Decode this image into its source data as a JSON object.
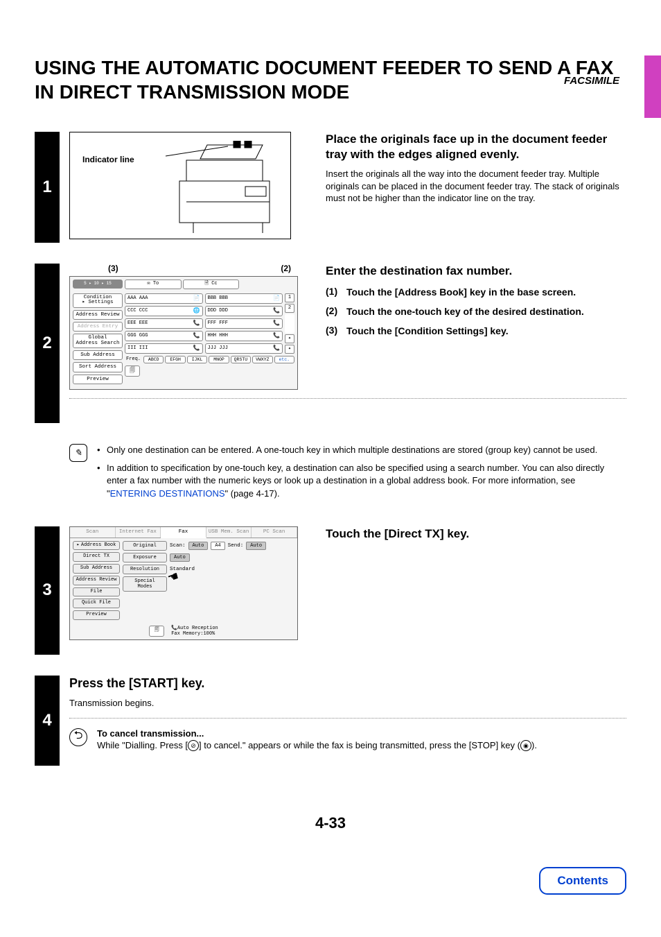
{
  "header": {
    "section": "FACSIMILE"
  },
  "title": "USING THE AUTOMATIC DOCUMENT FEEDER TO SEND A FAX IN DIRECT TRANSMISSION MODE",
  "steps": {
    "s1": {
      "num": "1",
      "indicator_label": "Indicator line",
      "heading": "Place the originals face up in the document feeder tray with the edges aligned evenly.",
      "para": "Insert the originals all the way into the document feeder tray. Multiple originals can be placed in the document feeder tray. The stack of originals must not be higher than the indicator line on the tray."
    },
    "s2": {
      "num": "2",
      "callout_left": "(3)",
      "callout_right": "(2)",
      "heading": "Enter the destination fax number.",
      "items": [
        {
          "n": "(1)",
          "t": "Touch the [Address Book] key in the base screen."
        },
        {
          "n": "(2)",
          "t": "Touch the one-touch key of the desired destination."
        },
        {
          "n": "(3)",
          "t": "Touch the [Condition Settings] key."
        }
      ],
      "panel": {
        "tab_to": "To",
        "tab_cc": "Cc",
        "side": [
          "Condition Settings",
          "Address Review",
          "Address Entry",
          "Global Address Search",
          "Sub Address",
          "Sort Address",
          "Preview"
        ],
        "keys": [
          [
            "AAA AAA",
            "BBB BBB"
          ],
          [
            "CCC CCC",
            "DDD DDD"
          ],
          [
            "EEE EEE",
            "FFF FFF"
          ],
          [
            "GGG GGG",
            "HHH HHH"
          ],
          [
            "III III",
            "JJJ JJJ"
          ]
        ],
        "scroll_top": "1",
        "scroll_bot": "2",
        "sort_label": "Freq.",
        "sort": [
          "ABCD",
          "EFGH",
          "IJKL",
          "MNOP",
          "QRSTU",
          "VWXYZ",
          "etc."
        ]
      },
      "note_b1": "Only one destination can be entered. A one-touch key in which multiple destinations are stored (group key) cannot be used.",
      "note_b2_pre": "In addition to specification by one-touch key, a destination can also be specified using a search number. You can also directly enter a fax number with the numeric keys or look up a destination in a global address book. For more information, see \"",
      "note_b2_link": "ENTERING DESTINATIONS",
      "note_b2_post": "\" (page 4-17)."
    },
    "s3": {
      "num": "3",
      "heading": "Touch the [Direct TX] key.",
      "panel": {
        "tabs": [
          "Scan",
          "Internet Fax",
          "Fax",
          "USB Mem. Scan",
          "PC Scan"
        ],
        "side": [
          "Address Book",
          "Direct TX",
          "Sub Address",
          "Address Review",
          "File",
          "Quick File",
          "Preview"
        ],
        "rows": {
          "original": "Original",
          "scan_lbl": "Scan:",
          "scan_val": "Auto",
          "size_val": "A4",
          "send_lbl": "Send:",
          "send_val": "Auto",
          "exposure": "Exposure",
          "exposure_val": "Auto",
          "resolution": "Resolution",
          "resolution_val": "Standard",
          "special": "Special Modes"
        },
        "status1": "Auto Reception",
        "status2": "Fax Memory:100%"
      }
    },
    "s4": {
      "num": "4",
      "heading": "Press the [START] key.",
      "para": "Transmission begins.",
      "cancel_title": "To cancel transmission...",
      "cancel_body_pre": "While \"Dialling. Press [",
      "cancel_body_mid": "] to cancel.\" appears or while the fax is being transmitted, press the [STOP] key (",
      "cancel_body_post": ")."
    }
  },
  "page_number": "4-33",
  "contents_btn": "Contents"
}
